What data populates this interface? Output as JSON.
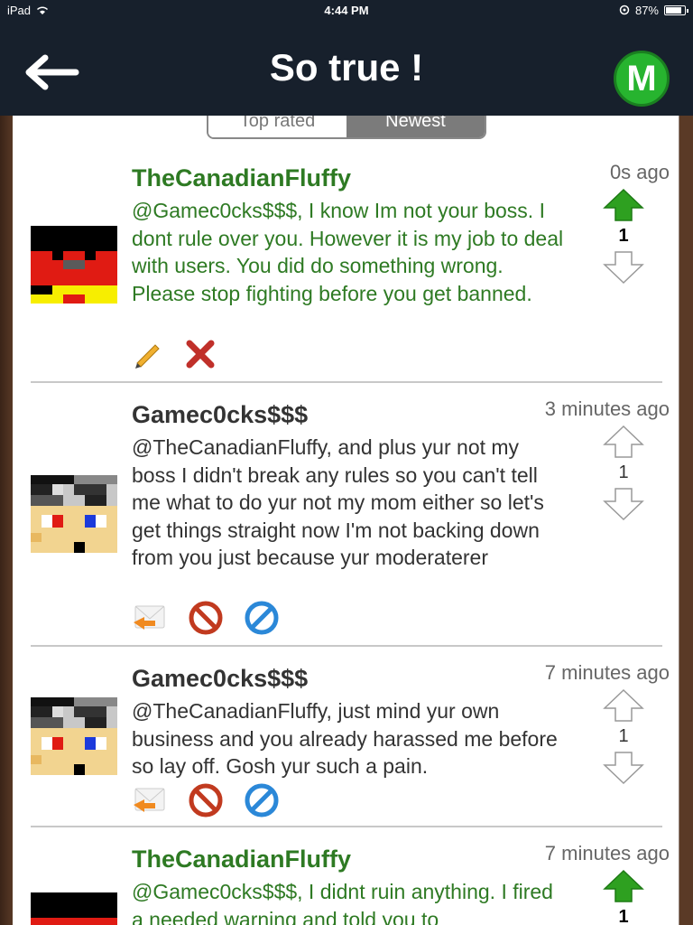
{
  "status": {
    "device": "iPad",
    "time": "4:44 PM",
    "battery": "87%",
    "battery_level": 0.87
  },
  "header": {
    "title": "So true !",
    "menu_letter": "M"
  },
  "tabs": [
    {
      "label": "Top rated"
    },
    {
      "label": "Newest"
    }
  ],
  "comments": [
    {
      "author": "TheCanadianFluffy",
      "time": "0s ago",
      "text": "@Gamec0cks$$$, I know Im not your boss. I dont rule over you. However it is my job to deal with users. You did do something wrong. Please stop fighting before you get banned.",
      "votes": "1",
      "actions": [
        "edit-icon",
        "delete-icon"
      ]
    },
    {
      "author": "Gamec0cks$$$",
      "time": "3 minutes ago",
      "text": "@TheCanadianFluffy, and plus yur not my boss I didn't break any rules so you can't tell me what to do yur not my mom either so let's get things straight now I'm not backing down from you just because yur moderaterer",
      "votes": "1",
      "actions": [
        "reply-icon",
        "report-icon",
        "block-icon"
      ]
    },
    {
      "author": "Gamec0cks$$$",
      "time": "7 minutes ago",
      "text": "@TheCanadianFluffy, just mind yur own business and you already harassed me before so lay off. Gosh yur such a pain.",
      "votes": "1",
      "actions": [
        "reply-icon",
        "report-icon",
        "block-icon"
      ]
    },
    {
      "author": "TheCanadianFluffy",
      "time": "7 minutes ago",
      "text": "@Gamec0cks$$$, I didnt ruin anything. I fired a needed warning and told you to",
      "votes": "1"
    }
  ]
}
